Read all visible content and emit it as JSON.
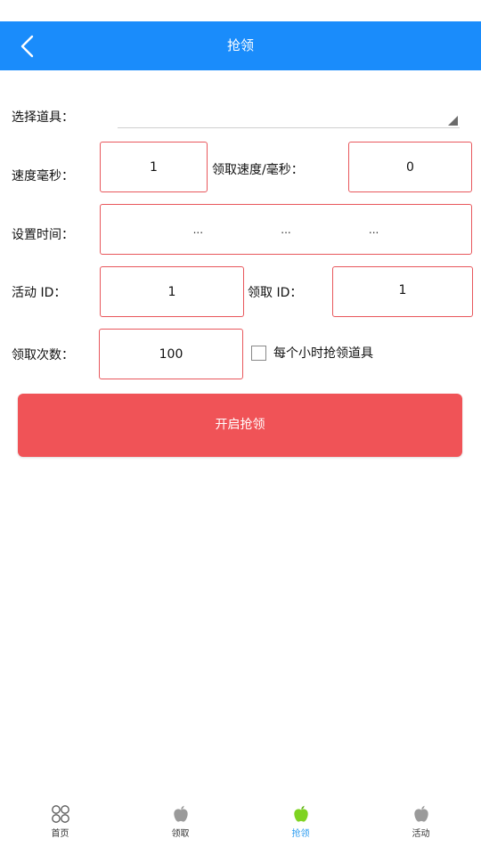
{
  "header": {
    "title": "抢领",
    "back_icon": "back-arrow-icon"
  },
  "form": {
    "select_item": {
      "label": "选择道具：",
      "value": ""
    },
    "speed": {
      "label": "速度毫秒：",
      "value": "1"
    },
    "claim_speed": {
      "label": "领取速度/毫秒：",
      "value": "0"
    },
    "set_time": {
      "label": "设置时间：",
      "segments": [
        "...",
        "...",
        "..."
      ]
    },
    "activity_id": {
      "label": "活动 ID：",
      "value": "1"
    },
    "claim_id": {
      "label": "领取 ID：",
      "value": "1"
    },
    "claim_count": {
      "label": "领取次数：",
      "value": "100"
    },
    "hourly_checkbox": {
      "label": "每个小时抢领道具",
      "checked": false
    },
    "start_button": "开启抢领"
  },
  "bottom_nav": {
    "items": [
      {
        "label": "首页",
        "icon": "grid-circles-icon",
        "active": false
      },
      {
        "label": "领取",
        "icon": "apple-icon",
        "active": false
      },
      {
        "label": "抢领",
        "icon": "apple-icon",
        "active": true
      },
      {
        "label": "活动",
        "icon": "apple-icon",
        "active": false
      }
    ]
  },
  "colors": {
    "header_bg": "#1a8cfb",
    "button_bg": "#f05357",
    "input_border": "#e8575c",
    "active_nav": "#2a9bf0",
    "active_icon": "#7ed321"
  }
}
